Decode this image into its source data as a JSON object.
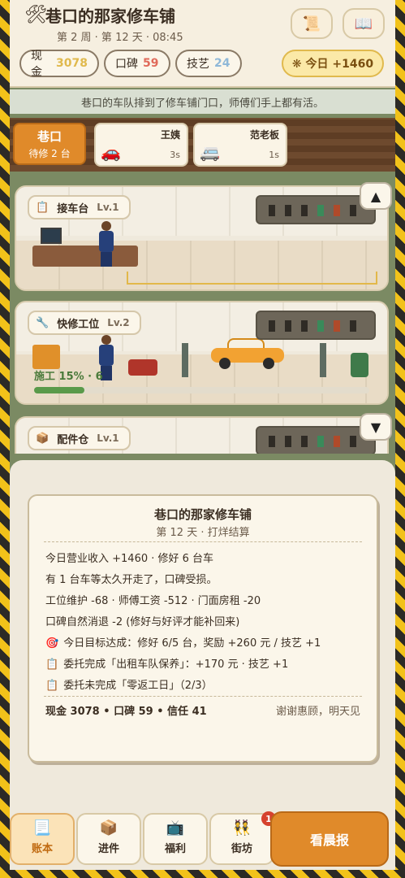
{
  "header": {
    "title": "巷口的那家修车铺",
    "subtitle": "第 2 周 · 第 12 天 · 08:45",
    "cash_label": "现金",
    "cash_value": "3078",
    "rep_label": "口碑",
    "rep_value": "59",
    "skill_label": "技艺",
    "skill_value": "24",
    "today_label": "❋ 今日 +1460",
    "scroll_icon": "scroll-icon",
    "book_icon": "book-icon"
  },
  "message": "巷口的车队排到了修车铺门口，师傅们手上都有活。",
  "queue": {
    "location": "巷口",
    "pending": "待修 2 台",
    "cars": [
      {
        "name": "王姨",
        "time": "3s",
        "icon": "sedan-icon"
      },
      {
        "name": "范老板",
        "time": "1s",
        "icon": "van-icon"
      }
    ]
  },
  "stations": [
    {
      "name": "接车台",
      "level": "Lv.1",
      "icon": "clipboard-icon"
    },
    {
      "name": "快修工位",
      "level": "Lv.2",
      "icon": "wrench-icon",
      "progress_text": "施工 15% · 6",
      "progress": 0.15
    },
    {
      "name": "配件仓",
      "level": "Lv.1",
      "icon": "box-icon"
    }
  ],
  "report": {
    "title": "巷口的那家修车铺",
    "subtitle": "第 12 天 · 打烊结算",
    "lines": [
      "今日营业收入 +1460 · 修好 6 台车",
      "有 1 台车等太久开走了，口碑受损。",
      "工位维护 -68 · 师傅工资 -512 · 门面房租 -20",
      "口碑自然消退 -2 (修好与好评才能补回来)",
      "今日目标达成：修好 6/5 台，奖励 +260 元 / 技艺 +1",
      "委托完成「出租车队保养」：+170 元 · 技艺 +1",
      "委托未完成「零返工日」（2/3）"
    ],
    "summary": "现金 3078 • 口碑 59 • 信任 41",
    "farewell": "谢谢惠顾，明天见"
  },
  "nav": {
    "ledger": "账本",
    "stock": "进件",
    "welfare": "福利",
    "neighbors": "街坊",
    "neighbors_badge": "1",
    "morning": "看晨报"
  },
  "colors": {
    "accent": "#e08a2a",
    "hazard": "#f2c21a",
    "progress": "#5a9a4a"
  }
}
